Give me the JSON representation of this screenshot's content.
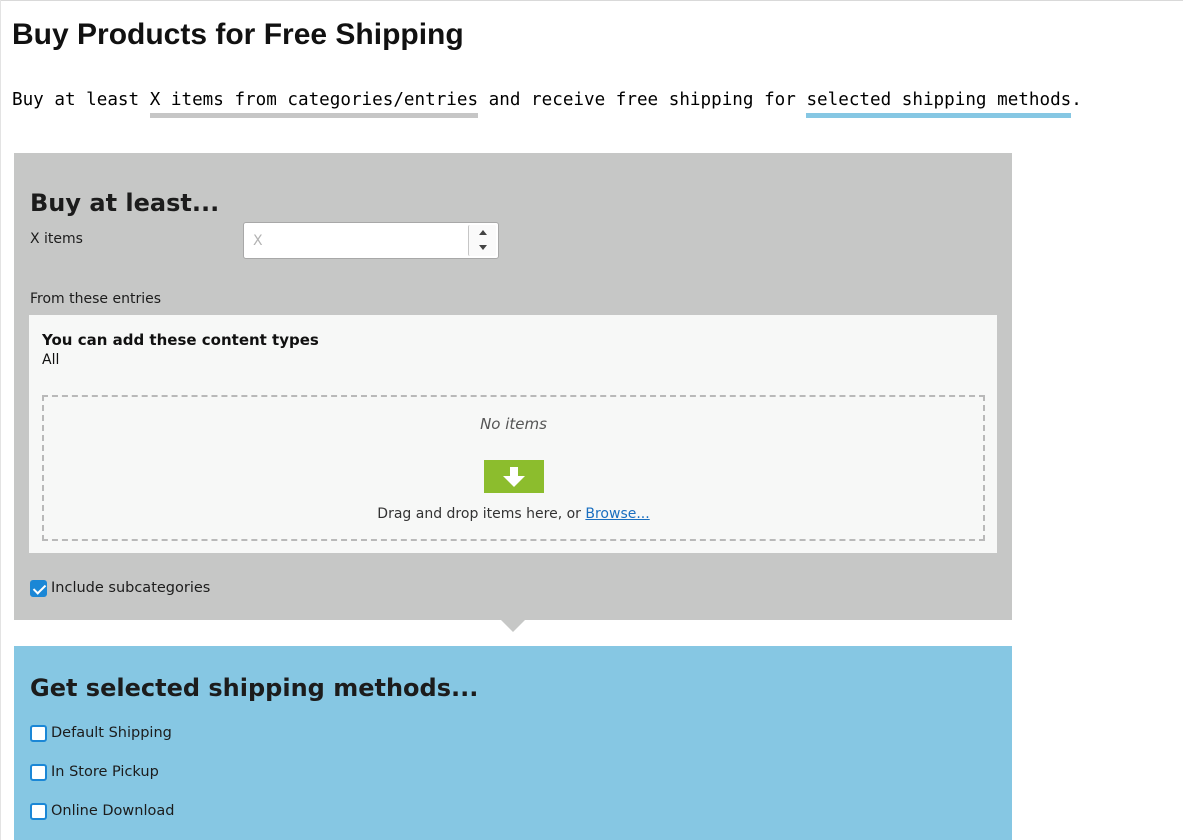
{
  "page": {
    "title": "Buy Products for Free Shipping"
  },
  "summary": {
    "part1": "Buy at least ",
    "highlight1": "X items from categories/entries",
    "part2": " and receive free shipping for ",
    "highlight2": "selected shipping methods",
    "part3": ".",
    "highlight1_color": "#c6c6c6",
    "highlight2_color": "#86c7e3"
  },
  "buy_section": {
    "heading": "Buy at least...",
    "x_items_label": "X items",
    "x_items_placeholder": "X",
    "x_items_value": "",
    "from_label": "From these entries",
    "content_types_title": "You can add these content types",
    "content_types_value": "All",
    "no_items": "No items",
    "drop_hint": "Drag and drop items here, or ",
    "browse_link": "Browse...",
    "include_subcategories_label": "Include subcategories",
    "include_subcategories_checked": true,
    "background_color": "#c6c7c6",
    "drop_icon": "download-arrow-icon",
    "drop_icon_color": "#8cbd2d"
  },
  "shipping_section": {
    "heading": "Get selected shipping methods...",
    "background_color": "#86c7e3",
    "methods": [
      {
        "label": "Default Shipping",
        "checked": false
      },
      {
        "label": "In Store Pickup",
        "checked": false
      },
      {
        "label": "Online Download",
        "checked": false
      }
    ]
  }
}
